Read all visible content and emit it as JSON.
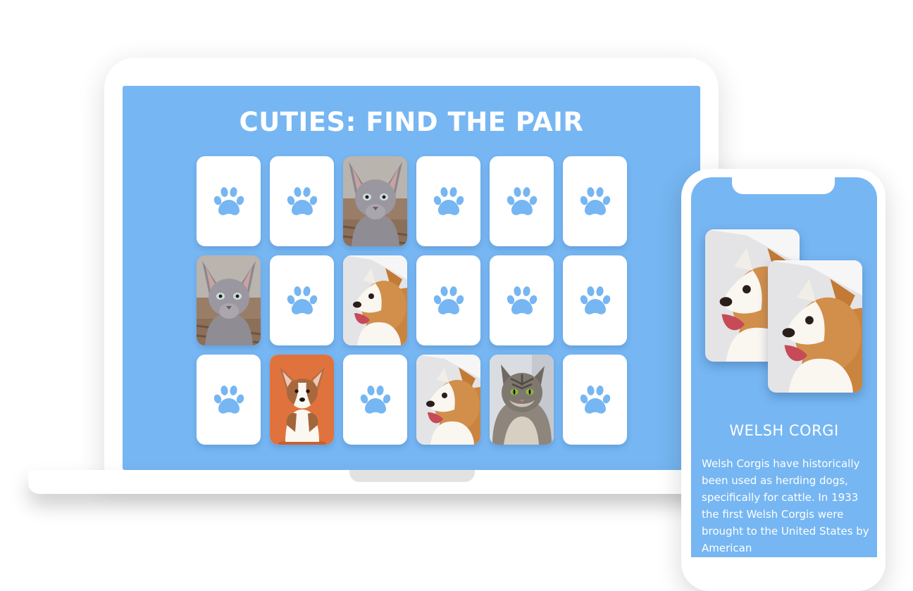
{
  "game": {
    "title": "CUTIES: FIND THE PAIR",
    "cards": [
      {
        "face": "paw"
      },
      {
        "face": "paw"
      },
      {
        "face": "sphynx-cat"
      },
      {
        "face": "paw"
      },
      {
        "face": "paw"
      },
      {
        "face": "paw"
      },
      {
        "face": "sphynx-cat"
      },
      {
        "face": "paw"
      },
      {
        "face": "welsh-corgi"
      },
      {
        "face": "paw"
      },
      {
        "face": "paw"
      },
      {
        "face": "paw"
      },
      {
        "face": "paw"
      },
      {
        "face": "corgi-puppy"
      },
      {
        "face": "paw"
      },
      {
        "face": "welsh-corgi"
      },
      {
        "face": "maine-coon-cat"
      },
      {
        "face": "paw"
      }
    ]
  },
  "detail": {
    "breed_name": "WELSH CORGI",
    "description": "Welsh Corgis have historically been used as herding dogs, specifically for cattle. In 1933 the first Welsh Corgis were brought to the United States by American",
    "matched_card_icon": "welsh-corgi"
  },
  "colors": {
    "screen_background": "#76b6f2",
    "paw": "#76b6f2",
    "card_back": "#ffffff"
  }
}
